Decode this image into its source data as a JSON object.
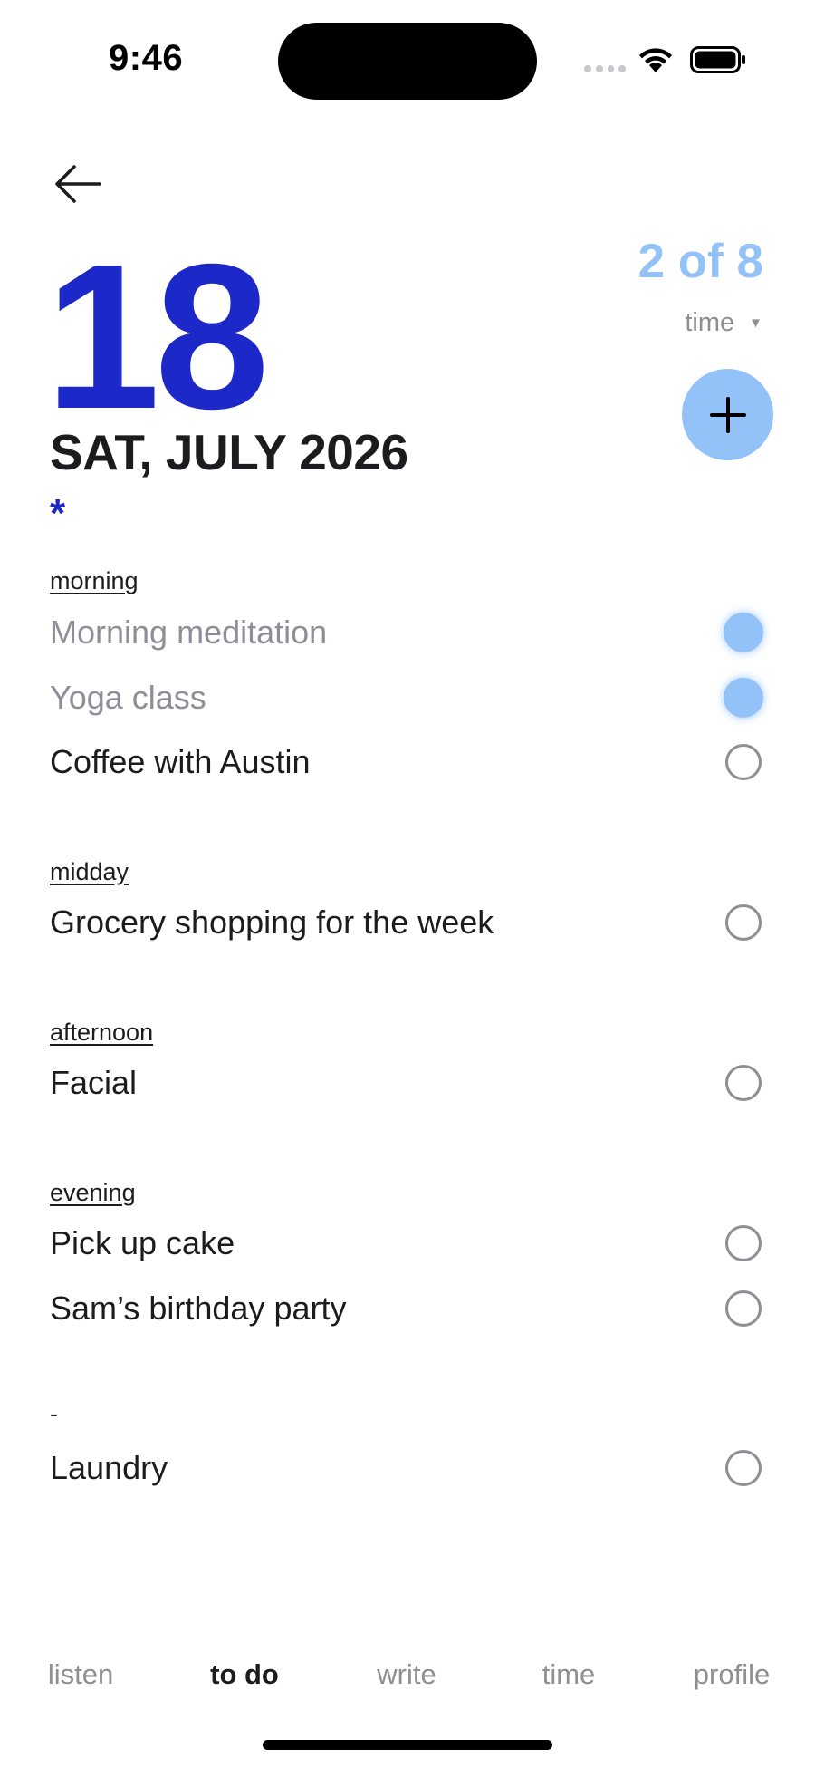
{
  "status_bar": {
    "time": "9:46"
  },
  "header": {
    "day_number": "18",
    "date_line": "SAT, JULY 2026",
    "marker": "*",
    "progress": "2 of 8",
    "sort_value": "time",
    "accent_color": "#1c28c8",
    "light_accent_color": "#93c2f8"
  },
  "sections": [
    {
      "label": "morning",
      "tasks": [
        {
          "text": "Morning meditation",
          "done": true
        },
        {
          "text": "Yoga class",
          "done": true
        },
        {
          "text": "Coffee with Austin",
          "done": false
        }
      ]
    },
    {
      "label": "midday",
      "tasks": [
        {
          "text": "Grocery shopping for the week",
          "done": false
        }
      ]
    },
    {
      "label": "afternoon",
      "tasks": [
        {
          "text": "Facial",
          "done": false
        }
      ]
    },
    {
      "label": "evening",
      "tasks": [
        {
          "text": "Pick up cake",
          "done": false
        },
        {
          "text": "Sam’s birthday party",
          "done": false
        }
      ]
    },
    {
      "label": "-",
      "tasks": [
        {
          "text": "Laundry",
          "done": false
        }
      ]
    }
  ],
  "tabs": [
    {
      "label": "listen",
      "active": false
    },
    {
      "label": "to do",
      "active": true
    },
    {
      "label": "write",
      "active": false
    },
    {
      "label": "time",
      "active": false
    },
    {
      "label": "profile",
      "active": false
    }
  ],
  "icons": {
    "back": "arrow-left-icon",
    "add": "plus-icon",
    "sort_caret": "caret-down-icon"
  }
}
